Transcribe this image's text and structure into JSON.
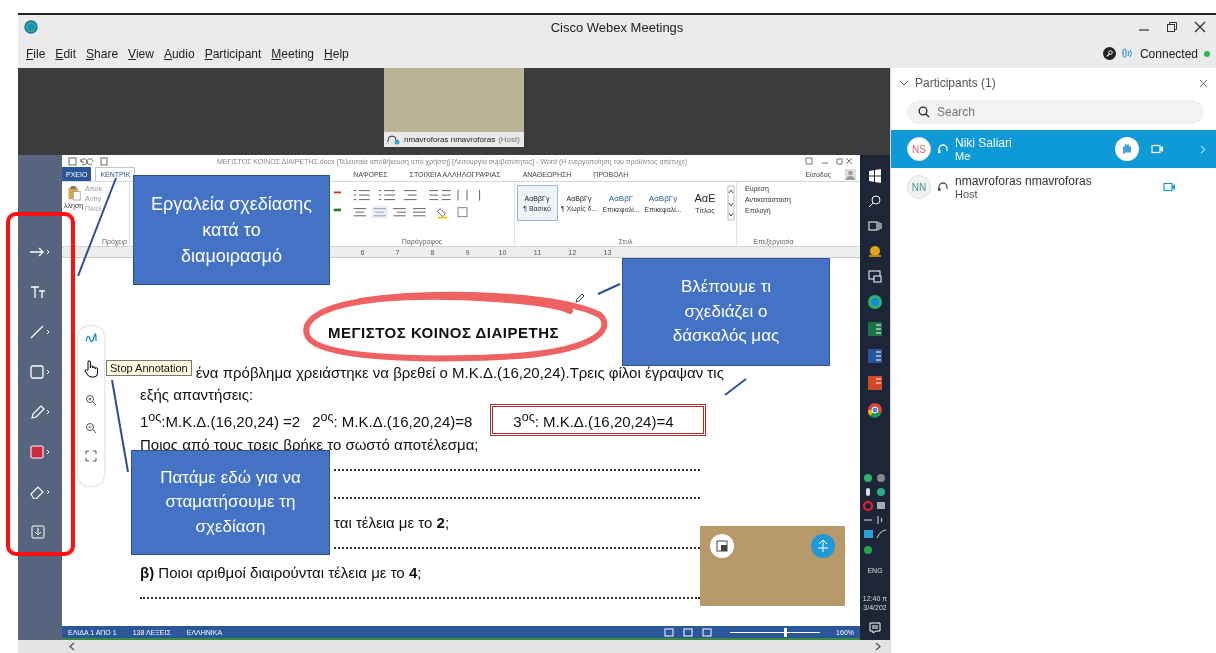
{
  "window": {
    "title": "Cisco Webex Meetings"
  },
  "menu": [
    {
      "label": "File"
    },
    {
      "label": "Edit"
    },
    {
      "label": "Share"
    },
    {
      "label": "View"
    },
    {
      "label": "Audio"
    },
    {
      "label": "Participant"
    },
    {
      "label": "Meeting"
    },
    {
      "label": "Help"
    }
  ],
  "connection": {
    "status": "Connected",
    "connected": true
  },
  "video": {
    "name": "nmavroforas nmavroforas",
    "role": "(Host)"
  },
  "annotation_tools": [
    {
      "kind": "arrow"
    },
    {
      "kind": "text"
    },
    {
      "kind": "line"
    },
    {
      "kind": "rectangle"
    },
    {
      "kind": "pen"
    },
    {
      "kind": "color"
    },
    {
      "kind": "eraser"
    },
    {
      "kind": "save"
    }
  ],
  "word": {
    "title": "ΜΕΓΙΣΤΟΣ ΚΟΙΝΟΣ ΔΙΑΙΡΕΤΗΣ.docx [Τελευταία αποθήκευση από χρήστη] [Λειτουργία συμβατότητας] - Word (Η ενεργοποίηση του προϊόντος απέτυχε)",
    "tabs": [
      {
        "label": "ΡΧΕΙΟ",
        "kind": "file",
        "selected": false
      },
      {
        "label": "ΚΕΝΤΡΙΚ",
        "kind": "tab",
        "selected": true
      },
      {
        "label": "ΝΑΦΟΡΕΣ",
        "kind": "tab",
        "selected": false
      },
      {
        "label": "ΣΤΟΙΧΕΙΑ ΑΛΛΗΛΟΓΡΑΦΙΑΣ",
        "kind": "tab",
        "selected": false
      },
      {
        "label": "ΑΝΑΘΕΩΡΗΣΗ",
        "kind": "tab",
        "selected": false
      },
      {
        "label": "ΠΡΟΒΟΛΗ",
        "kind": "tab",
        "selected": false
      }
    ],
    "account": "Είσοδος",
    "clipboard": {
      "paste": "λληση",
      "items": [
        "Αποκ",
        "Αντιγ",
        "Πινέλ"
      ],
      "label": "Πρόχειρ"
    },
    "paragraph_label": "Παράγραφος",
    "styles": [
      {
        "sample": "ΑαΒβΓγ",
        "name": "¶ Βασικό",
        "selected": true
      },
      {
        "sample": "ΑαΒβΓγ",
        "name": "¶ Χωρίς δ...",
        "selected": false
      },
      {
        "sample": "ΑαΒβΓ",
        "name": "Επικεφαλί...",
        "selected": false
      },
      {
        "sample": "ΑαΒβΓγ",
        "name": "Επικεφαλί...",
        "selected": false
      },
      {
        "sample": "ΑαΕ",
        "name": "Τίτλος",
        "selected": false
      }
    ],
    "styles_label": "Στυλ",
    "editing": {
      "items": [
        "Εύρεση",
        "Αντικατάσταση",
        "Επιλογή"
      ],
      "label": "Επεξεργασία"
    },
    "ruler": [
      "6",
      "7",
      "8",
      "9",
      "10",
      "11",
      "12",
      "13"
    ],
    "document": [
      {
        "kind": "title",
        "text": "ΜΕΓΙΣΤΟΣ ΚΟΙΝΟΣ ΔΙΑΙΡΕΤΗΣ"
      },
      {
        "kind": "text",
        "tooltip": "Stop Annotation",
        "text": "ένα πρόβλημα χρειάστηκε να βρεθεί ο Μ.Κ.Δ.(16,20,24).Τρεις φίλοι έγραψαν τις"
      },
      {
        "kind": "text",
        "text": "εξής απαντήσεις:"
      },
      {
        "kind": "answers",
        "items": [
          "1$^{ος}$:Μ.Κ.Δ.(16,20,24) =2",
          "2$^{ος}$: Μ.Κ.Δ.(16,20,24)=8"
        ],
        "boxed": "3$^{ος}$: Μ.Κ.Δ.(16,20,24)=4"
      },
      {
        "kind": "text",
        "text": "Ποιος από τους τρεις βρήκε το σωστό αποτέλεσμα;"
      },
      {
        "kind": "dots_tail"
      },
      {
        "kind": "dots_tail"
      },
      {
        "kind": "fragment",
        "text": "ται τέλεια με το **2**;"
      },
      {
        "kind": "dots_tail"
      },
      {
        "kind": "text",
        "text": "**β)** Ποιοι αριθμοί διαιρούνται τέλεια με το **4**;"
      },
      {
        "kind": "dots"
      }
    ],
    "status": [
      "ΕΛΙΔΑ 1 ΑΠΟ 1",
      "138 ΛΕΞΕΙΣ",
      "ΕΛΛΗΝΙΚΑ"
    ],
    "zoom": {
      "label": "160%",
      "level": 0.6
    }
  },
  "taskbar": {
    "language": "ENG",
    "time": "12:40 π",
    "date": "3/4/202"
  },
  "callouts": [
    {
      "text": "Εργαλεία σχεδίασης κατά το διαμοιρασμό"
    },
    {
      "text": "Βλέπουμε τι σχεδιάζει ο δάσκαλός μας"
    },
    {
      "text": "Πατάμε εδώ για να σταματήσουμε τη σχεδίαση"
    }
  ],
  "participants_panel": {
    "title": "Participants (1)",
    "search_placeholder": "Search",
    "participants": [
      {
        "initials": "NS",
        "color": "#e0646c",
        "name": "Niki Saliari",
        "role": "Me",
        "selected": true
      },
      {
        "initials": "NN",
        "color": "#3a9a8c",
        "name": "nmavroforas nmavroforas",
        "role": "Host",
        "selected": false
      }
    ]
  }
}
